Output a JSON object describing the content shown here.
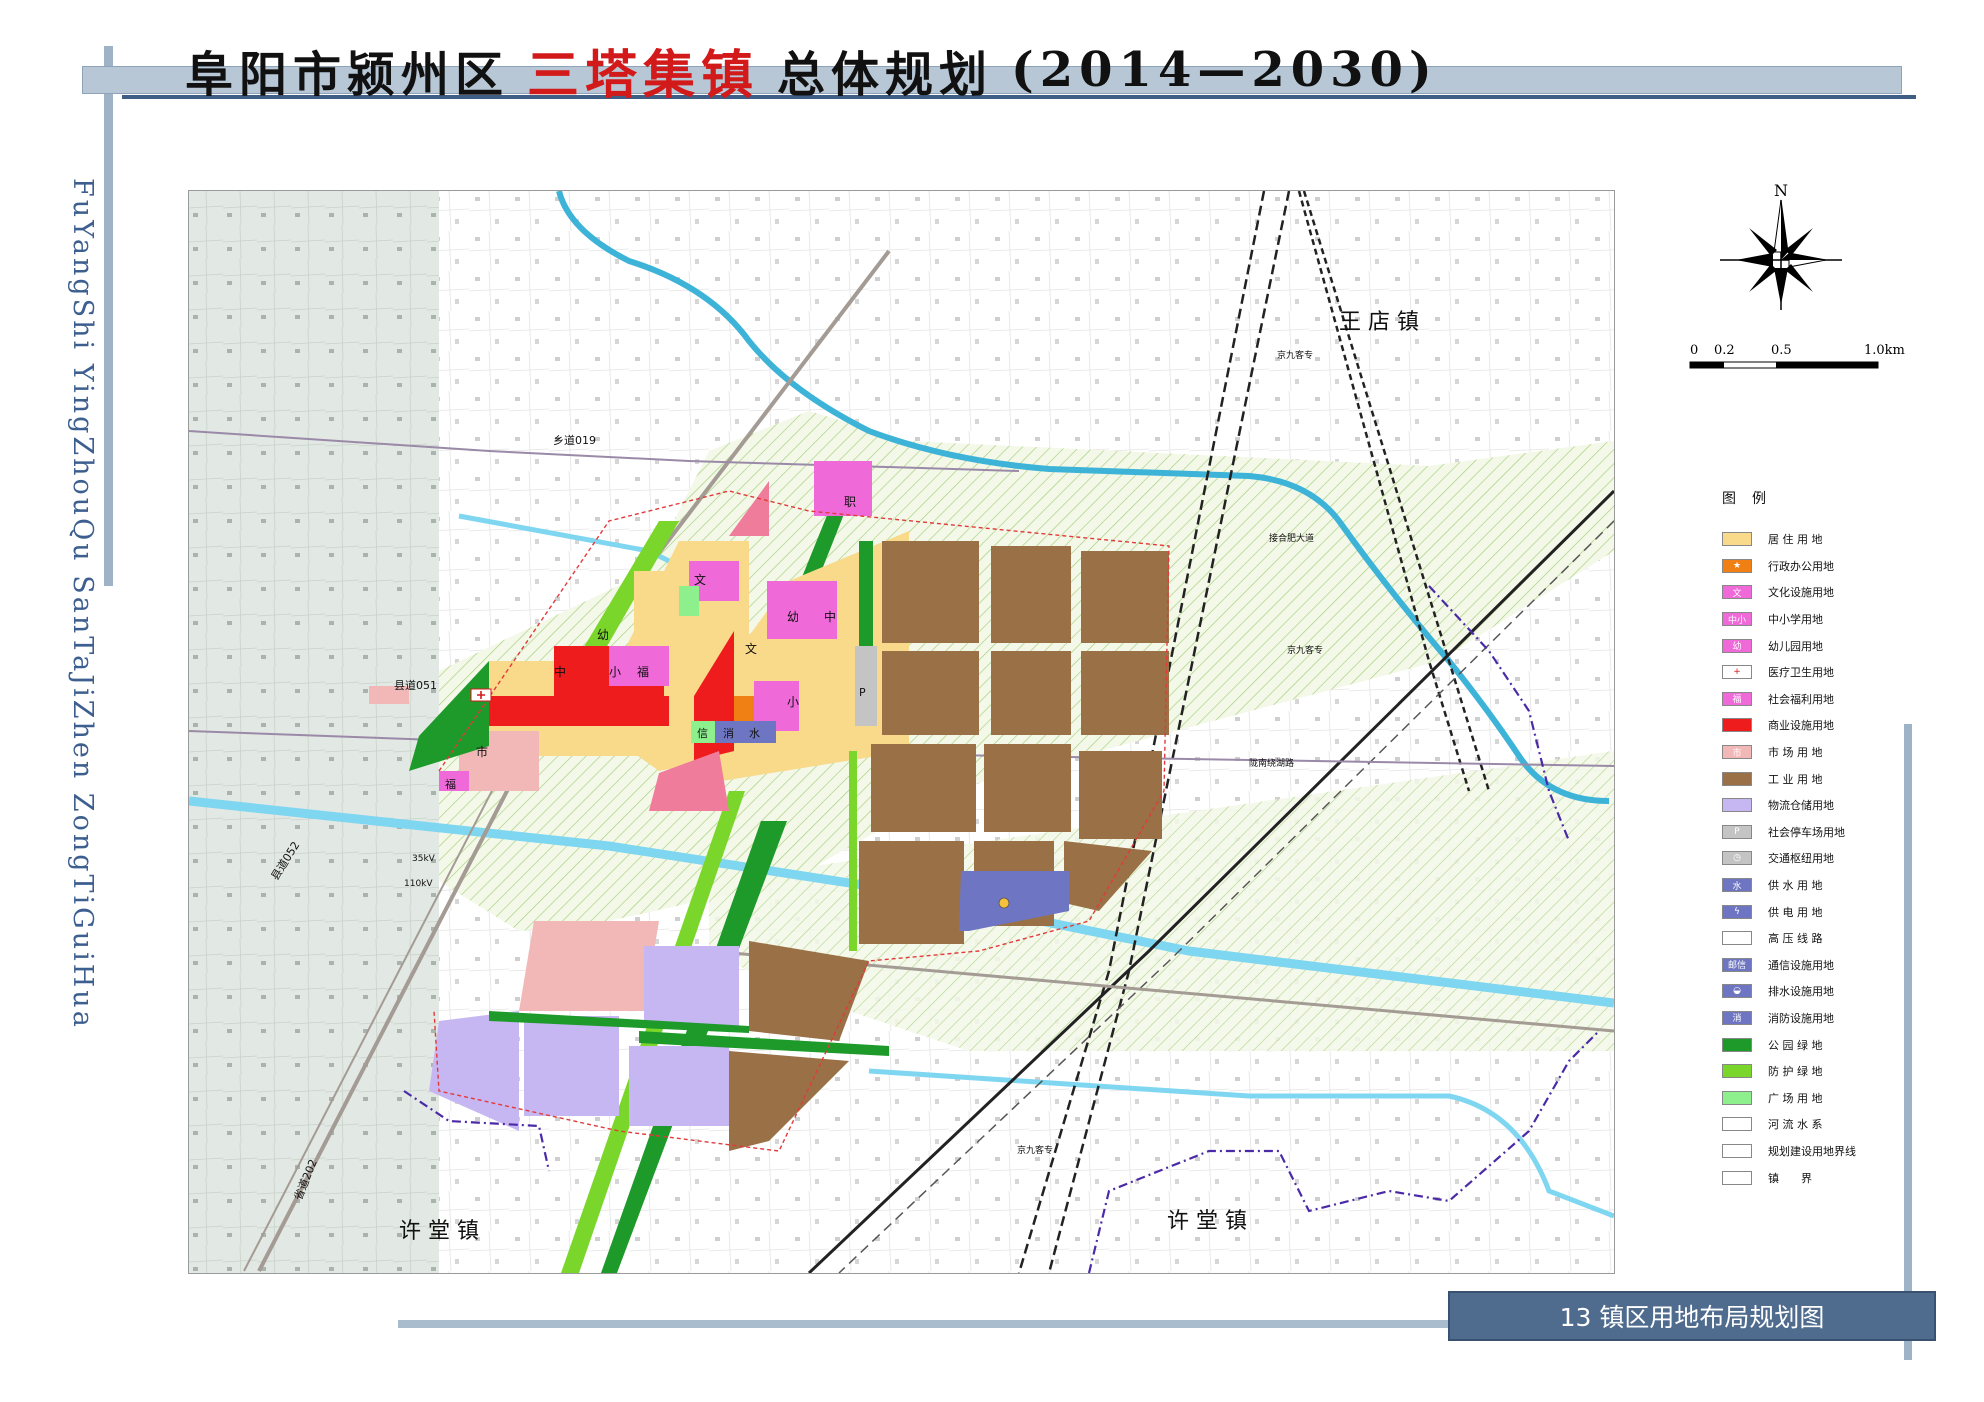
{
  "header": {
    "title_part1": "阜阳市颍州区",
    "title_highlight": "三塔集镇",
    "title_part2": "总体规划",
    "title_years": "(2014—2030)"
  },
  "side_caption": "FuYangShi YingZhouQu SanTaJiZhen ZongTiGuiHua",
  "map_caption": "13 镇区用地布局规划图",
  "north_label": "N",
  "scale": {
    "ticks": [
      "0",
      "0.2",
      "0.5",
      "1.0km"
    ]
  },
  "legend": {
    "title": "图例",
    "items": [
      {
        "label": "居 住 用 地",
        "color": "#f9d98a",
        "mark": ""
      },
      {
        "label": "行政办公用地",
        "color": "#f07f14",
        "mark": "★"
      },
      {
        "label": "文化设施用地",
        "color": "#ef6ad8",
        "mark": "文"
      },
      {
        "label": "中小学用地",
        "color": "#ef6ad8",
        "mark": "中小"
      },
      {
        "label": "幼儿园用地",
        "color": "#ef6ad8",
        "mark": "幼"
      },
      {
        "label": "医疗卫生用地",
        "color": "#ffffff",
        "mark": "+"
      },
      {
        "label": "社会福利用地",
        "color": "#ef6ad8",
        "mark": "福"
      },
      {
        "label": "商业设施用地",
        "color": "#ee1c1c",
        "mark": ""
      },
      {
        "label": "市 场 用 地",
        "color": "#f2b7b7",
        "mark": "市"
      },
      {
        "label": "工 业 用 地",
        "color": "#9a7046",
        "mark": ""
      },
      {
        "label": "物流仓储用地",
        "color": "#c6b6f2",
        "mark": ""
      },
      {
        "label": "社会停车场用地",
        "color": "#c4c4c4",
        "mark": "P"
      },
      {
        "label": "交通枢纽用地",
        "color": "#c4c4c4",
        "mark": "◷"
      },
      {
        "label": "供 水 用 地",
        "color": "#6e76c3",
        "mark": "水"
      },
      {
        "label": "供 电 用 地",
        "color": "#6e76c3",
        "mark": "ϟ"
      },
      {
        "label": "高 压 线 路",
        "color": "#ffffff",
        "mark": ""
      },
      {
        "label": "通信设施用地",
        "color": "#6e76c3",
        "mark": "邮信"
      },
      {
        "label": "排水设施用地",
        "color": "#6e76c3",
        "mark": "◒"
      },
      {
        "label": "消防设施用地",
        "color": "#6e76c3",
        "mark": "消"
      },
      {
        "label": "公 园 绿 地",
        "color": "#1d9a2a",
        "mark": ""
      },
      {
        "label": "防 护 绿 地",
        "color": "#7bd62b",
        "mark": ""
      },
      {
        "label": "广 场 用 地",
        "color": "#8df08d",
        "mark": ""
      },
      {
        "label": "河 流 水 系",
        "color": "#ffffff",
        "mark": ""
      },
      {
        "label": "规划建设用地界线",
        "color": "#ffffff",
        "mark": ""
      },
      {
        "label": "镇　　界",
        "color": "#ffffff",
        "mark": ""
      }
    ]
  },
  "map": {
    "place_names": {
      "wangdian": "王 店 镇",
      "xutang_left": "许 堂 镇",
      "xutang_right": "许 堂 镇"
    },
    "road_labels": {
      "xiangdao019": "乡道019",
      "xiandao051": "县道051",
      "xiandao052": "县道052",
      "shengdao202": "省道202",
      "jingjiu_top": "京九客专",
      "jingjiu_mid": "京九客专",
      "jingjiu_bottom": "京九客专",
      "jiehe": "接合肥大道",
      "shuhuai": "陇南绕湖路",
      "kv35": "35kV",
      "kv110": "110kV"
    },
    "facility_marks": {
      "wen1": "文",
      "wen2": "文",
      "zhong1": "中",
      "zhong2": "中",
      "xiao1": "小",
      "xiao2": "小",
      "you1": "幼",
      "you2": "幼",
      "fu1": "福",
      "fu2": "福",
      "zhi": "职",
      "shi": "市",
      "xin": "信",
      "xiao_fire": "消",
      "shui": "水",
      "p": "P"
    }
  },
  "colors": {
    "residential": "#f9d98a",
    "commercial": "#ee1c1c",
    "industrial": "#9a7046",
    "logistics": "#c6b6f2",
    "public": "#ef6ad8",
    "park": "#1d9a2a",
    "buffer": "#7bd62b",
    "water": "#7fd6f0",
    "utility": "#6e76c3",
    "market": "#f2b7b7",
    "title_accent": "#d21a1a"
  }
}
